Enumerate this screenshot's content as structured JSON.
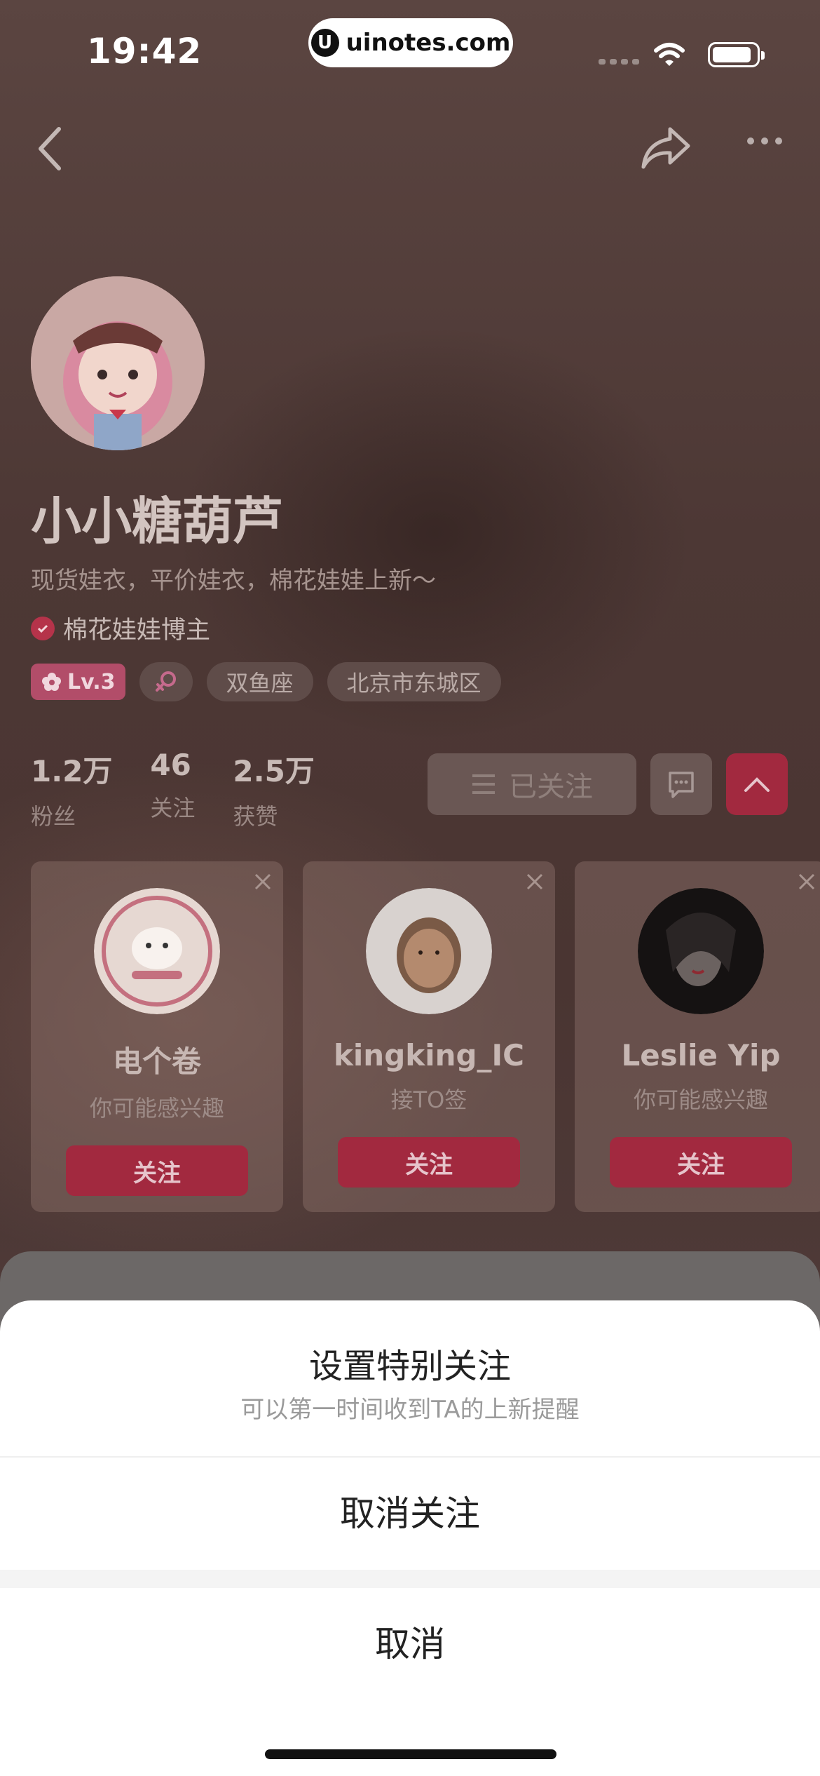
{
  "status_bar": {
    "time": "19:42",
    "url_logo": "U",
    "url": "uinotes.com"
  },
  "profile": {
    "name": "小小糖葫芦",
    "bio": "现货娃衣，平价娃衣，棉花娃娃上新～",
    "verified_label": "棉花娃娃博主",
    "level": "Lv.3",
    "tags": [
      "双鱼座",
      "北京市东城区"
    ],
    "stats": [
      {
        "value": "1.2万",
        "label": "粉丝"
      },
      {
        "value": "46",
        "label": "关注"
      },
      {
        "value": "2.5万",
        "label": "获赞"
      }
    ],
    "followed_label": "已关注"
  },
  "recommendations": [
    {
      "name": "电个卷",
      "desc": "你可能感兴趣",
      "button": "关注"
    },
    {
      "name": "kingking_IC",
      "desc": "接TO签",
      "button": "关注"
    },
    {
      "name": "Leslie Yip",
      "desc": "你可能感兴趣",
      "button": "关注"
    }
  ],
  "sheet": {
    "special_title": "设置特别关注",
    "special_subtitle": "可以第一时间收到TA的上新提醒",
    "unfollow": "取消关注",
    "cancel": "取消"
  },
  "colors": {
    "accent": "#a2293f",
    "sheet_bg": "#ffffff"
  }
}
